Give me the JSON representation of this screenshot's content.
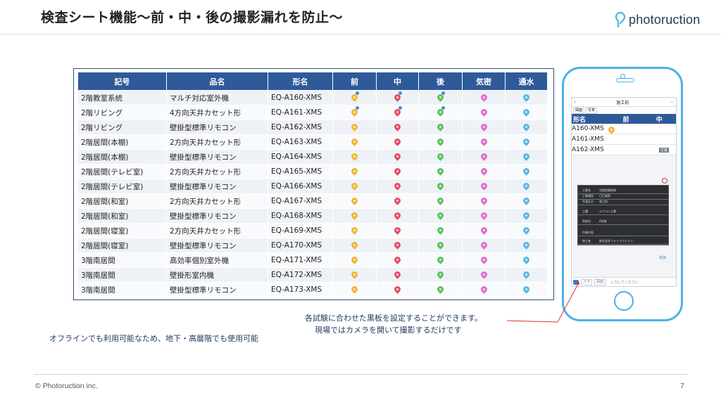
{
  "title": "検査シート機能～前・中・後の撮影漏れを防止～",
  "logo": {
    "text": "photoruction"
  },
  "table": {
    "headers": [
      "記号",
      "品名",
      "形名",
      "前",
      "中",
      "後",
      "気密",
      "通水"
    ],
    "rows": [
      {
        "symbol": "2階教室系統",
        "product": "マルチ対応室外機",
        "model": "EQ-A160-XMS"
      },
      {
        "symbol": "2階リビング",
        "product": "4方向天井カセット形",
        "model": "EQ-A161-XMS"
      },
      {
        "symbol": "2階リビング",
        "product": "壁掛型標準リモコン",
        "model": "EQ-A162-XMS"
      },
      {
        "symbol": "2階居間(本棚)",
        "product": "2方向天井カセット形",
        "model": "EQ-A163-XMS"
      },
      {
        "symbol": "2階居間(本棚)",
        "product": "壁掛型標準リモコン",
        "model": "EQ-A164-XMS"
      },
      {
        "symbol": "2階居間(テレビ室)",
        "product": "2方向天井カセット形",
        "model": "EQ-A165-XMS"
      },
      {
        "symbol": "2階居間(テレビ室)",
        "product": "壁掛型標準リモコン",
        "model": "EQ-A166-XMS"
      },
      {
        "symbol": "2階居間(和室)",
        "product": "2方向天井カセット形",
        "model": "EQ-A167-XMS"
      },
      {
        "symbol": "2階居間(和室)",
        "product": "壁掛型標準リモコン",
        "model": "EQ-A168-XMS"
      },
      {
        "symbol": "2階居間(寝室)",
        "product": "2方向天井カセット形",
        "model": "EQ-A169-XMS"
      },
      {
        "symbol": "2階居間(寝室)",
        "product": "壁掛型標準リモコン",
        "model": "EQ-A170-XMS"
      },
      {
        "symbol": "3階南居間",
        "product": "高効率個別室外機",
        "model": "EQ-A171-XMS"
      },
      {
        "symbol": "3階南居間",
        "product": "壁掛形室内機",
        "model": "EQ-A172-XMS"
      },
      {
        "symbol": "3階南居間",
        "product": "壁掛型標準リモコン",
        "model": "EQ-A173-XMS"
      }
    ],
    "pin_colors": [
      "#f0b63a",
      "#e2506a",
      "#5cc25a",
      "#df6fd1",
      "#5ab8e8"
    ]
  },
  "phone": {
    "screen_title": "施工前",
    "tabs": [
      "図面",
      "写真"
    ],
    "mini_headers": [
      "形名",
      "前",
      "中"
    ],
    "mini_rows": [
      "A160-XMS",
      "A161-XMS",
      "A162-XMS"
    ],
    "badge": "位置",
    "board_labels": [
      "工事名",
      "工事場所",
      "写真区分",
      "工種",
      "系統名",
      "作業内容",
      "施工者"
    ],
    "board_values": [
      "空調設備改修",
      "〇〇病院",
      "施工前",
      "エアコン工事",
      "A系統",
      "",
      "株式会社フォトラクション"
    ],
    "footer_label": "追加",
    "bottom_buttons": [
      "メモ",
      "図面"
    ],
    "input_placeholder": "入力してください"
  },
  "callout": {
    "line1": "各試験に合わせた黒板を設定することができます。",
    "line2": "現場ではカメラを開いて撮影するだけです"
  },
  "note": "オフラインでも利用可能なため、地下・高層階でも使用可能",
  "footer": {
    "copyright": "© Photoruction inc.",
    "page_number": "7"
  }
}
